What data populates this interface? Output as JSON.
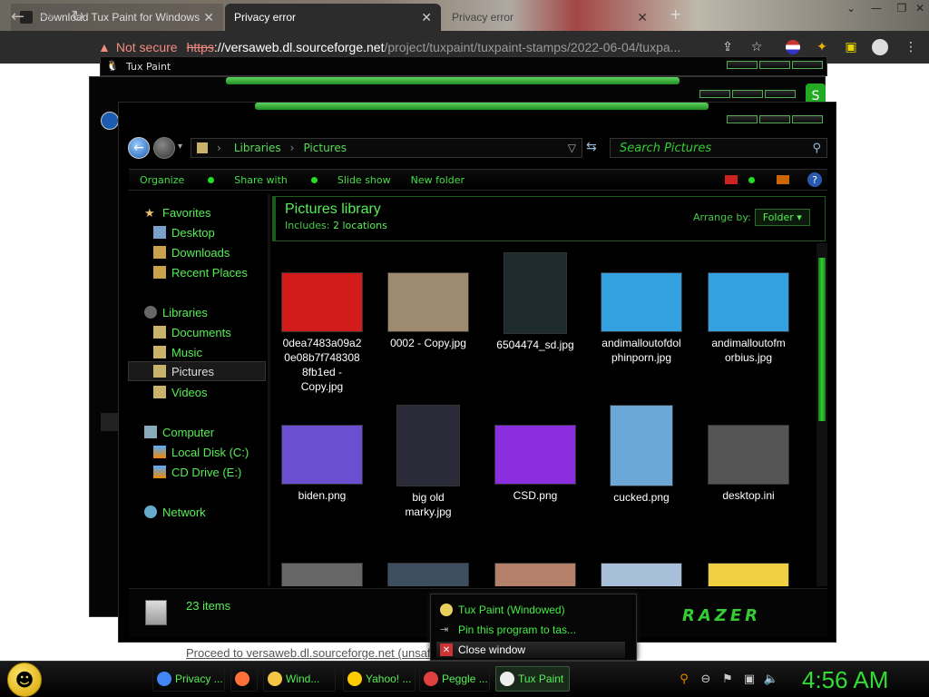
{
  "browser": {
    "tabs": [
      {
        "title": "Download Tux Paint for Windows",
        "active": false
      },
      {
        "title": "Privacy error",
        "active": true
      },
      {
        "title": "Privacy error",
        "active": false
      }
    ],
    "new_tab": "+",
    "security_label": "Not secure",
    "url_scheme": "https",
    "url_sep": "://",
    "url_host": "versaweb.dl.sourceforge.net",
    "url_path": "/project/tuxpaint/tuxpaint-stamps/2022-06-04/tuxpa...",
    "proceed_link": "Proceed to versaweb.dl.sourceforge.net (unsaf"
  },
  "back_window": {
    "title": "Tux Paint"
  },
  "explorer": {
    "breadcrumb": [
      "Libraries",
      "Pictures"
    ],
    "search_placeholder": "Search Pictures",
    "commands": [
      "Organize",
      "Share with",
      "Slide show",
      "New folder"
    ],
    "nav": {
      "favorites": "Favorites",
      "desktop": "Desktop",
      "downloads": "Downloads",
      "recent": "Recent Places",
      "libraries": "Libraries",
      "documents": "Documents",
      "music": "Music",
      "pictures": "Pictures",
      "videos": "Videos",
      "computer": "Computer",
      "local_disk": "Local Disk (C:)",
      "cd_drive": "CD Drive (E:)",
      "network": "Network"
    },
    "library_title": "Pictures library",
    "includes_label": "Includes:",
    "includes_value": "2 locations",
    "arrange_label": "Arrange by:",
    "arrange_value": "Folder",
    "files": [
      {
        "name": "0dea7483a09a20e08b7f7483088fb1ed - Copy.jpg",
        "lines": [
          "0dea7483a09a2",
          "0e08b7f748308",
          "8fb1ed -",
          "Copy.jpg"
        ],
        "color": "#d21b1b"
      },
      {
        "name": "0002 - Copy.jpg",
        "lines": [
          "0002 - Copy.jpg"
        ],
        "color": "#9e8a6e"
      },
      {
        "name": "6504474_sd.jpg",
        "lines": [
          "6504474_sd.jpg"
        ],
        "color": "#1e2b2e"
      },
      {
        "name": "andimalloutofdolphinporn.jpg",
        "lines": [
          "andimalloutofdol",
          "phinporn.jpg"
        ],
        "color": "#33a0e0"
      },
      {
        "name": "andimalloutofmorbius.jpg",
        "lines": [
          "andimalloutofm",
          "orbius.jpg"
        ],
        "color": "#33a0e0"
      },
      {
        "name": "biden.png",
        "lines": [
          "biden.png"
        ],
        "color": "#6a4fd0"
      },
      {
        "name": "big old marky.jpg",
        "lines": [
          "big old",
          "marky.jpg"
        ],
        "color": "#2a2a38"
      },
      {
        "name": "CSD.png",
        "lines": [
          "CSD.png"
        ],
        "color": "#8a2ee0"
      },
      {
        "name": "cucked.png",
        "lines": [
          "cucked.png"
        ],
        "color": "#6ba8d8"
      },
      {
        "name": "desktop.ini",
        "lines": [
          "desktop.ini"
        ],
        "color": "#555555"
      },
      {
        "name": "",
        "lines": [],
        "color": "#666666"
      },
      {
        "name": "",
        "lines": [],
        "color": "#3d4e5e"
      },
      {
        "name": "",
        "lines": [],
        "color": "#b4806a"
      },
      {
        "name": "",
        "lines": [],
        "color": "#a7bfd8"
      },
      {
        "name": "",
        "lines": [],
        "color": "#f0d040"
      }
    ],
    "item_count": "23 items",
    "brand": "RAZER"
  },
  "jumplist": {
    "app": "Tux Paint (Windowed)",
    "pin": "Pin this program to tas...",
    "close": "Close window"
  },
  "taskbar": {
    "items": [
      {
        "label": "Privacy ...",
        "color": "#4285f4"
      },
      {
        "label": "",
        "color": "#ff7139"
      },
      {
        "label": "Wind...",
        "color": "#f4c542"
      },
      {
        "label": "Yahoo! ...",
        "color": "#ffcc00"
      },
      {
        "label": "Peggle ...",
        "color": "#e04040"
      },
      {
        "label": "Tux Paint",
        "color": "#eeeeee"
      }
    ],
    "clock": "4:56 AM"
  },
  "colors": {
    "accent_green": "#55ee55",
    "warning_red": "#f28b82"
  }
}
